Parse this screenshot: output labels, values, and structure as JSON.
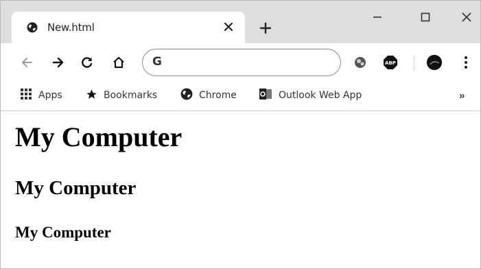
{
  "tab": {
    "title": "New.html",
    "favicon": "globe-icon"
  },
  "window_controls": {
    "minimize": "minimize-icon",
    "maximize": "maximize-icon",
    "close": "close-icon"
  },
  "toolbar": {
    "omnibox_value": "",
    "omnibox_prefix_icon": "google-g-icon",
    "extensions": [
      "extension-icon",
      "adblock-icon"
    ],
    "profile": "profile-avatar"
  },
  "bookmarks": {
    "items": [
      {
        "label": "Apps",
        "icon": "apps-grid-icon"
      },
      {
        "label": "Bookmarks",
        "icon": "star-icon"
      },
      {
        "label": "Chrome",
        "icon": "chrome-globe-icon"
      },
      {
        "label": "Outlook Web App",
        "icon": "outlook-icon"
      }
    ],
    "overflow": "»"
  },
  "page": {
    "h1": "My Computer",
    "h2": "My Computer",
    "h3": "My Computer"
  },
  "colors": {
    "titlebar": "#dedede",
    "tab_active": "#ffffff",
    "text": "#202124"
  }
}
